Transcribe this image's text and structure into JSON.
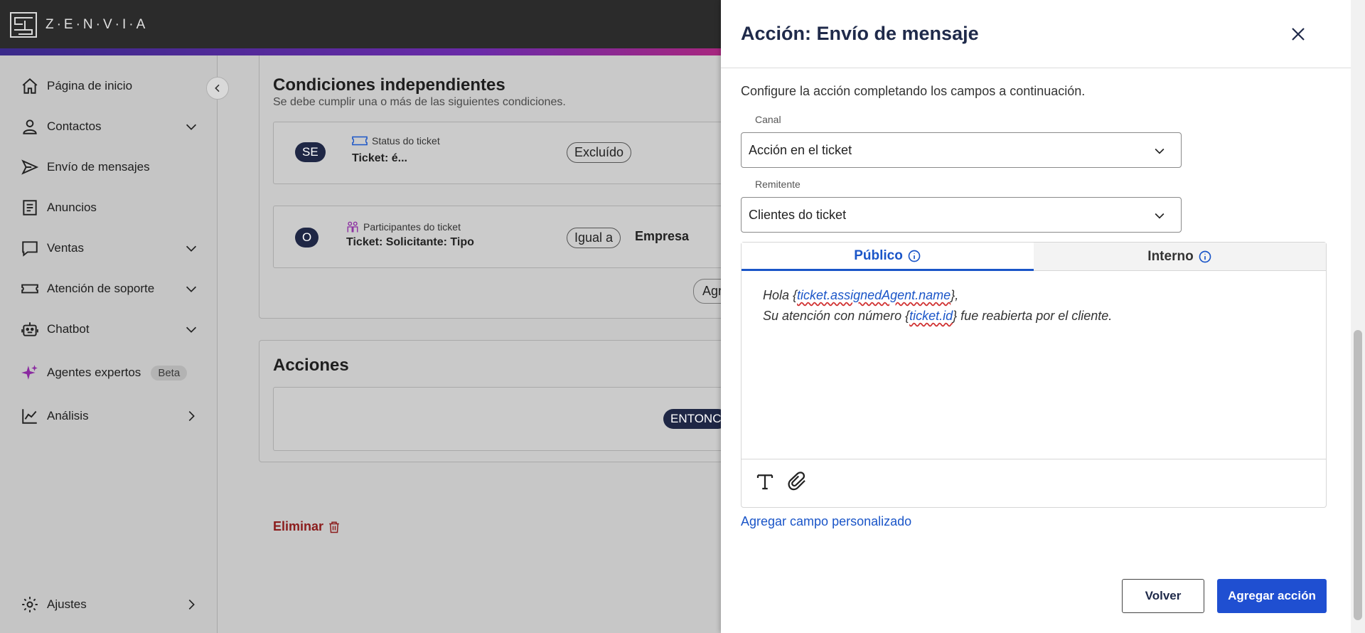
{
  "app": {
    "logo_text": "Z·E·N·V·I·A"
  },
  "sidebar": {
    "items": [
      {
        "label": "Página de inicio",
        "icon": "home-icon"
      },
      {
        "label": "Contactos",
        "icon": "user-icon"
      },
      {
        "label": "Envío de mensajes",
        "icon": "send-icon"
      },
      {
        "label": "Anuncios",
        "icon": "document-icon"
      },
      {
        "label": "Ventas",
        "icon": "chat-icon"
      },
      {
        "label": "Atención de soporte",
        "icon": "ticket-icon"
      },
      {
        "label": "Chatbot",
        "icon": "robot-icon"
      },
      {
        "label": "Agentes expertos",
        "icon": "sparkle-icon",
        "badge": "Beta"
      },
      {
        "label": "Análisis",
        "icon": "chart-icon"
      }
    ],
    "footer": {
      "label": "Ajustes",
      "icon": "gear-icon"
    }
  },
  "main": {
    "conditions": {
      "title": "Condiciones independientes",
      "subtitle": "Se debe cumplir una o más de las siguientes condiciones.",
      "rows": [
        {
          "connector": "SE",
          "field_label": "Status do ticket",
          "field_value": "Ticket: é...",
          "operator": "Excluído",
          "value": ""
        },
        {
          "connector": "O",
          "field_label": "Participantes do ticket",
          "field_value": "Ticket: Solicitante: Tipo",
          "operator": "Igual a",
          "value": "Empresa"
        }
      ],
      "add_button_partial": "Agr"
    },
    "actions": {
      "title": "Acciones",
      "then_pill": "ENTONC"
    },
    "delete_label": "Eliminar"
  },
  "drawer": {
    "title": "Acción: Envío de mensaje",
    "instructions": "Configure la acción completando los campos a continuación.",
    "canal": {
      "label": "Canal",
      "value": "Acción en el ticket"
    },
    "remitente": {
      "label": "Remitente",
      "value": "Clientes do ticket"
    },
    "tabs": {
      "public": "Público",
      "internal": "Interno"
    },
    "message": {
      "line1_prefix": "Hola {",
      "line1_var": "ticket.assignedAgent.name",
      "line1_suffix": "},",
      "line2_prefix": "Su atención con número {",
      "line2_var": "ticket.id",
      "line2_suffix": "} fue reabierta por el cliente."
    },
    "add_custom_field": "Agregar campo personalizado",
    "back_button": "Volver",
    "add_action_button": "Agregar acción"
  },
  "colors": {
    "accent": "#1f4fd1",
    "link": "#1a55c8",
    "title": "#1f2a4a",
    "danger": "#8b1c1c"
  }
}
